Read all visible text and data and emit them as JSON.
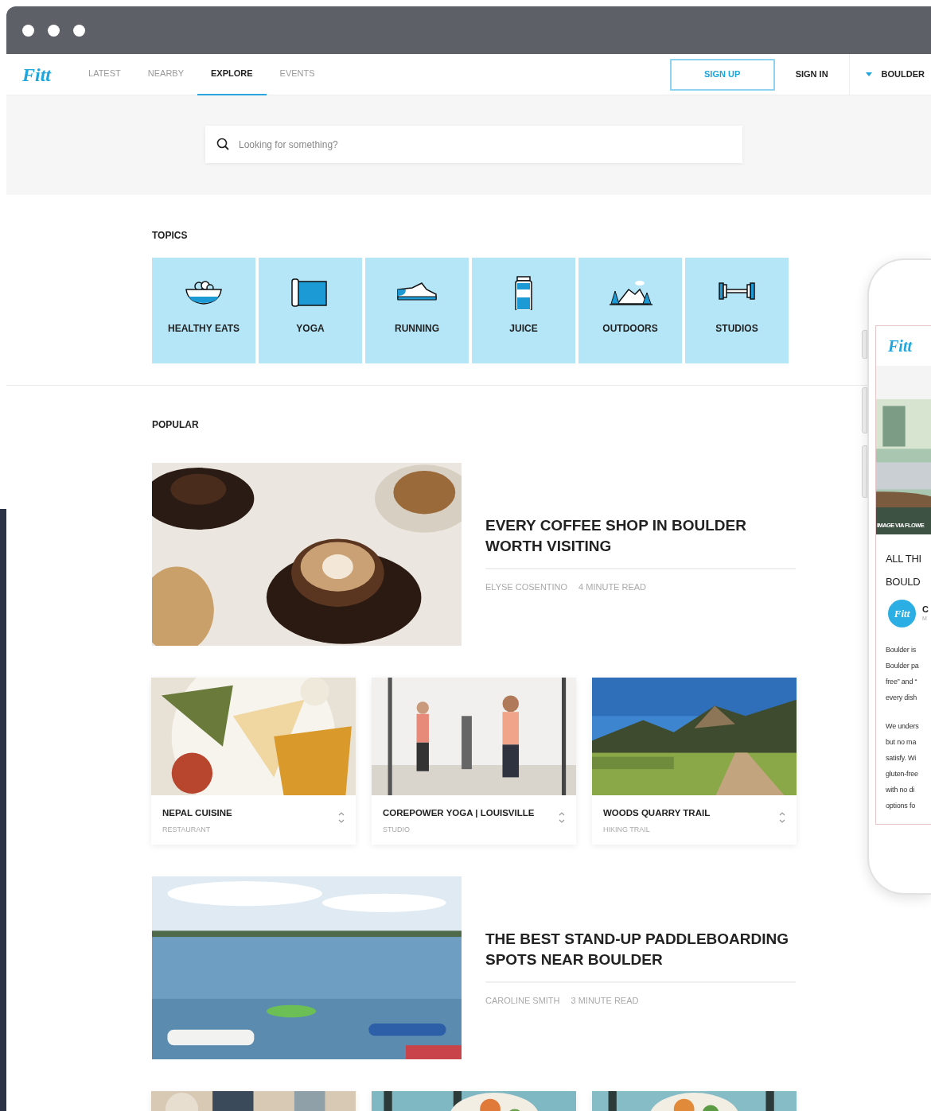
{
  "nav": {
    "logo": "Fitt",
    "tabs": [
      {
        "label": "LATEST",
        "selected": false
      },
      {
        "label": "NEARBY",
        "selected": false
      },
      {
        "label": "EXPLORE",
        "selected": true
      },
      {
        "label": "EVENTS",
        "selected": false
      }
    ],
    "sign_up": "SIGN UP",
    "sign_in": "SIGN IN",
    "city": "BOULDER"
  },
  "search": {
    "placeholder": "Looking for something?"
  },
  "topics": {
    "heading": "TOPICS",
    "items": [
      {
        "label": "HEALTHY EATS"
      },
      {
        "label": "YOGA"
      },
      {
        "label": "RUNNING"
      },
      {
        "label": "JUICE"
      },
      {
        "label": "OUTDOORS"
      },
      {
        "label": "STUDIOS"
      }
    ]
  },
  "popular": {
    "heading": "POPULAR",
    "rows": [
      {
        "kind": "feature",
        "title": "EVERY COFFEE SHOP IN BOULDER WORTH VISITING",
        "author": "ELYSE COSENTINO",
        "read_time": "4 MINUTE READ"
      },
      {
        "kind": "places",
        "places": [
          {
            "name": "NEPAL CUISINE",
            "category": "RESTAURANT"
          },
          {
            "name": "COREPOWER YOGA | LOUISVILLE",
            "category": "STUDIO"
          },
          {
            "name": "WOODS QUARRY TRAIL",
            "category": "HIKING TRAIL"
          }
        ]
      },
      {
        "kind": "feature",
        "title": "THE BEST STAND-UP PADDLEBOARDING SPOTS NEAR BOULDER",
        "author": "CAROLINE SMITH",
        "read_time": "3 MINUTE READ"
      },
      {
        "kind": "places"
      }
    ]
  },
  "phone": {
    "logo": "Fitt",
    "image_credit": "IMAGE VIA FLOWE",
    "title_lines": [
      "ALL THI",
      "BOULD"
    ],
    "avatar_logo": "Fitt",
    "author_initial": "C",
    "meta_initial": "M",
    "paragraphs": [
      [
        "Boulder is",
        "Boulder pa",
        "free” and “",
        "every dish"
      ],
      [
        "We unders",
        "but no ma",
        "satisfy. Wi",
        "gluten-free",
        "with no di",
        "options fo"
      ]
    ]
  }
}
